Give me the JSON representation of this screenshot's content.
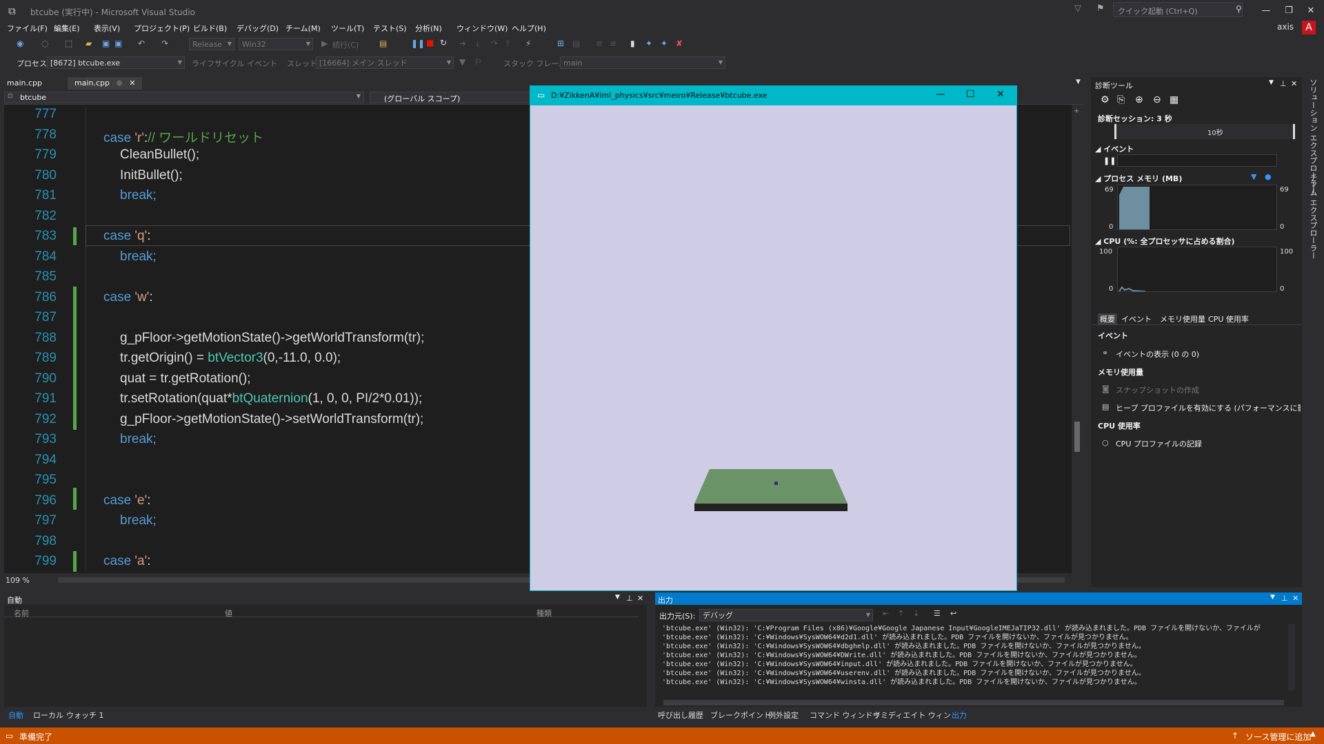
{
  "window": {
    "title": "btcube (実行中) - Microsoft Visual Studio"
  },
  "quick_launch": {
    "placeholder": "クイック起動 (Ctrl+Q)"
  },
  "user": {
    "name": "axis",
    "avatar": "A"
  },
  "menu": [
    "ファイル(F)",
    "編集(E)",
    "表示(V)",
    "プロジェクト(P)",
    "ビルド(B)",
    "デバッグ(D)",
    "チーム(M)",
    "ツール(T)",
    "テスト(S)",
    "分析(N)",
    "ウィンドウ(W)",
    "ヘルプ(H)"
  ],
  "toolbar": {
    "config": "Release",
    "platform": "Win32",
    "continue_label": "続行(C)",
    "process_label": "プロセス:",
    "process": "[8672] btcube.exe",
    "lifecycle_label": "ライフサイクル イベント",
    "thread_label": "スレッド:",
    "thread": "[16664] メイン スレッド",
    "stackframe_label": "スタック フレーム:",
    "stackframe": "main"
  },
  "editor": {
    "tabs": [
      "main.cpp",
      "main.cpp"
    ],
    "project_scope": "btcube",
    "global_scope": "(グローバル スコープ)",
    "zoom": "109 %",
    "line_numbers": [
      "777",
      "778",
      "779",
      "780",
      "781",
      "782",
      "783",
      "784",
      "785",
      "786",
      "787",
      "788",
      "789",
      "790",
      "791",
      "792",
      "793",
      "794",
      "795",
      "796",
      "797",
      "798",
      "799"
    ],
    "code": {
      "l778_kw": "case ",
      "l778_str": "'r'",
      "l778_rest": ":",
      "l778_cm": "// ワールドリセット",
      "l779": "CleanBullet();",
      "l780": "InitBullet();",
      "l781": "break;",
      "l783_kw": "case ",
      "l783_str": "'q'",
      "l783_rest": ":",
      "l784": "break;",
      "l786_kw": "case ",
      "l786_str": "'w'",
      "l786_rest": ":",
      "l788": "g_pFloor->getMotionState()->getWorldTransform(tr);",
      "l789_a": "tr.getOrigin() = ",
      "l789_ty": "btVector3",
      "l789_b": "(0,-11.0, 0.0);",
      "l790": "quat = tr.getRotation();",
      "l791_a": "tr.setRotation(quat*",
      "l791_ty": "btQuaternion",
      "l791_b": "(1, 0, 0, PI/2*0.01));",
      "l792": "g_pFloor->getMotionState()->setWorldTransform(tr);",
      "l793": "break;",
      "l796_kw": "case ",
      "l796_str": "'e'",
      "l796_rest": ":",
      "l797": "break;",
      "l799_kw": "case ",
      "l799_str": "'a'",
      "l799_rest": ":"
    }
  },
  "app_window": {
    "title": "D:¥ZikkenA¥iml_physics¥src¥meiro¥Release¥btcube.exe",
    "background": "#cfcde6",
    "floor_color": "#6b9368"
  },
  "diagnostics": {
    "title": "診断ツール",
    "session": "診断セッション: 3 秒",
    "timeline_label": "10秒",
    "events_label": "イベント",
    "memory_label": "プロセス メモリ (MB)",
    "memory_max": "69",
    "memory_min": "0",
    "cpu_label": "CPU (%: 全プロセッサに占める割合)",
    "cpu_max": "100",
    "cpu_min": "0",
    "tabs": [
      "概要",
      "イベント",
      "メモリ使用量",
      "CPU 使用率"
    ],
    "events_section": "イベント",
    "show_events": "イベントの表示 (0 の 0)",
    "memory_section": "メモリ使用量",
    "snapshot": "スナップショットの作成",
    "heap_profile": "ヒープ プロファイルを有効にする (パフォーマンスに影響し",
    "cpu_section": "CPU 使用率",
    "cpu_profile": "CPU プロファイルの記録"
  },
  "side_tabs": [
    "ソリューション エクスプローラー",
    "チーム エクスプローラー"
  ],
  "autos": {
    "title": "自動",
    "columns": [
      "名前",
      "値",
      "種類"
    ],
    "tabs": [
      "自動",
      "ローカル",
      "ウォッチ 1"
    ]
  },
  "output": {
    "title": "出力",
    "source_label": "出力元(S):",
    "source": "デバッグ",
    "lines": [
      "'btcube.exe' (Win32): 'C:¥Program Files (x86)¥Google¥Google Japanese Input¥GoogleIMEJaTIP32.dll' が読み込まれました。PDB ファイルを開けないか、ファイルが",
      "'btcube.exe' (Win32): 'C:¥Windows¥SysWOW64¥d2d1.dll' が読み込まれました。PDB ファイルを開けないか、ファイルが見つかりません。",
      "'btcube.exe' (Win32): 'C:¥Windows¥SysWOW64¥dbghelp.dll' が読み込まれました。PDB ファイルを開けないか、ファイルが見つかりません。",
      "'btcube.exe' (Win32): 'C:¥Windows¥SysWOW64¥DWrite.dll' が読み込まれました。PDB ファイルを開けないか、ファイルが見つかりません。",
      "'btcube.exe' (Win32): 'C:¥Windows¥SysWOW64¥input.dll' が読み込まれました。PDB ファイルを開けないか、ファイルが見つかりません。",
      "'btcube.exe' (Win32): 'C:¥Windows¥SysWOW64¥userenv.dll' が読み込まれました。PDB ファイルを開けないか、ファイルが見つかりません。",
      "'btcube.exe' (Win32): 'C:¥Windows¥SysWOW64¥winsta.dll' が読み込まれました。PDB ファイルを開けないか、ファイルが見つかりません。"
    ],
    "tabs": [
      "呼び出し履歴",
      "ブレークポイント",
      "例外設定",
      "コマンド ウィンドウ",
      "イミディエイト ウィンドウ",
      "出力"
    ]
  },
  "status": {
    "ready": "準備完了",
    "source_control": "ソース管理に追加"
  }
}
